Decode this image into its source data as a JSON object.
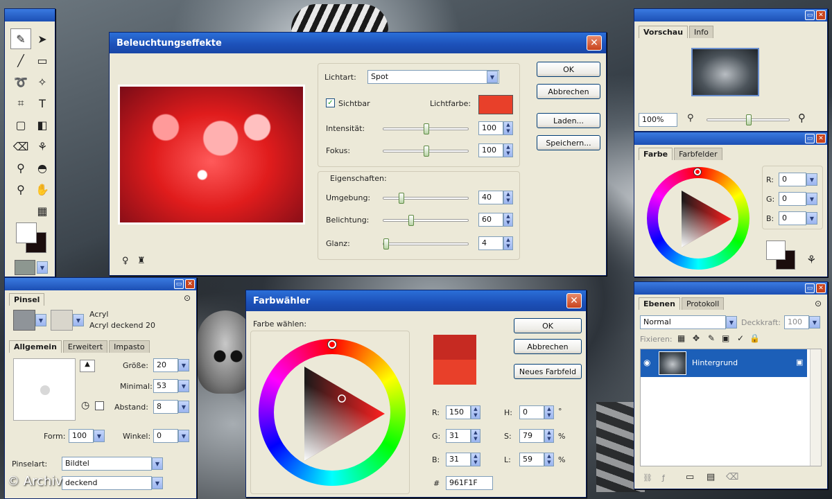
{
  "lighting_dialog": {
    "title": "Beleuchtungseffekte",
    "lichtart_label": "Lichtart:",
    "lichtart_value": "Spot",
    "sichtbar_label": "Sichtbar",
    "lichtfarbe_label": "Lichtfarbe:",
    "lichtfarbe_color": "#e8402a",
    "intensitaet_label": "Intensität:",
    "intensitaet_value": "100",
    "fokus_label": "Fokus:",
    "fokus_value": "100",
    "eigenschaften_label": "Eigenschaften:",
    "umgebung_label": "Umgebung:",
    "umgebung_value": "40",
    "belichtung_label": "Belichtung:",
    "belichtung_value": "60",
    "glanz_label": "Glanz:",
    "glanz_value": "4",
    "ok": "OK",
    "abbrechen": "Abbrechen",
    "laden": "Laden...",
    "speichern": "Speichern..."
  },
  "color_picker": {
    "title": "Farbwähler",
    "farbe_waehlen": "Farbe wählen:",
    "ok": "OK",
    "abbrechen": "Abbrechen",
    "neues_farbfeld": "Neues Farbfeld",
    "new_color": "#c62a22",
    "old_color": "#e8402a",
    "r_label": "R:",
    "r_value": "150",
    "g_label": "G:",
    "g_value": "31",
    "b_label": "B:",
    "b_value": "31",
    "h_label": "H:",
    "h_value": "0",
    "h_unit": "°",
    "s_label": "S:",
    "s_value": "79",
    "s_unit": "%",
    "l_label": "L:",
    "l_value": "59",
    "l_unit": "%",
    "hash": "#",
    "hex_value": "961F1F"
  },
  "vorschau_panel": {
    "tab_vorschau": "Vorschau",
    "tab_info": "Info",
    "zoom": "100%"
  },
  "farbe_panel": {
    "tab_farbe": "Farbe",
    "tab_farbfelder": "Farbfelder",
    "r_label": "R:",
    "r_value": "0",
    "g_label": "G:",
    "g_value": "0",
    "b_label": "B:",
    "b_value": "0"
  },
  "ebenen_panel": {
    "tab_ebenen": "Ebenen",
    "tab_protokoll": "Protokoll",
    "blend_mode": "Normal",
    "deckkraft_label": "Deckkraft:",
    "deckkraft_value": "100",
    "fixieren_label": "Fixieren:",
    "layer_name": "Hintergrund"
  },
  "pinsel_panel": {
    "tab_pinsel": "Pinsel",
    "brush_name": "Acryl",
    "brush_sub": "Acryl deckend 20",
    "tab_allgemein": "Allgemein",
    "tab_erweitert": "Erweitert",
    "tab_impasto": "Impasto",
    "groesse_label": "Größe:",
    "groesse_value": "20",
    "minimal_label": "Minimal:",
    "minimal_value": "53",
    "abstand_label": "Abstand:",
    "abstand_value": "8",
    "form_label": "Form:",
    "form_value": "100",
    "winkel_label": "Winkel:",
    "winkel_value": "0",
    "pinselart_label": "Pinselart:",
    "pinselart_value": "Bildtel",
    "second_value": "deckend"
  },
  "watermark": "© Archiv"
}
